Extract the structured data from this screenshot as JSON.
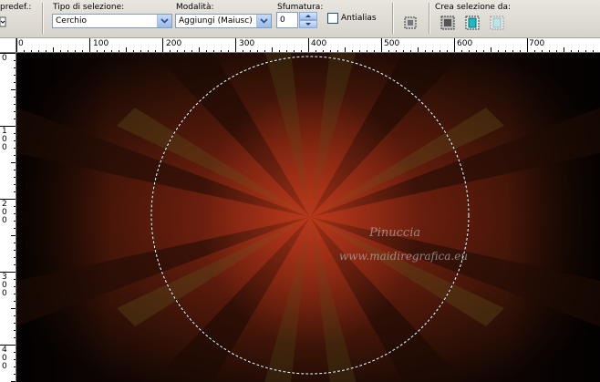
{
  "toolbar": {
    "preset_label": "predef.:",
    "selection_type": {
      "label": "Tipo di selezione:",
      "value": "Cerchio"
    },
    "mode": {
      "label": "Modalità:",
      "value": "Aggiungi (Maiusc)"
    },
    "feather": {
      "label": "Sfumatura:",
      "value": "0"
    },
    "antialias": {
      "label": "Antialias",
      "checked": false
    },
    "create_from": {
      "label": "Crea selezione da:"
    }
  },
  "ruler": {
    "top_labels": [
      "0",
      "100",
      "200",
      "300",
      "400",
      "500",
      "600",
      "700"
    ],
    "left_labels": [
      "0",
      "100",
      "200",
      "300",
      "400"
    ]
  },
  "canvas": {
    "watermark_line1": "Pinuccia",
    "watermark_line2": "www.maidiregrafica.eu",
    "colors": {
      "center": "#b0321a",
      "mid": "#5e2a10",
      "dark": "#130604"
    }
  }
}
